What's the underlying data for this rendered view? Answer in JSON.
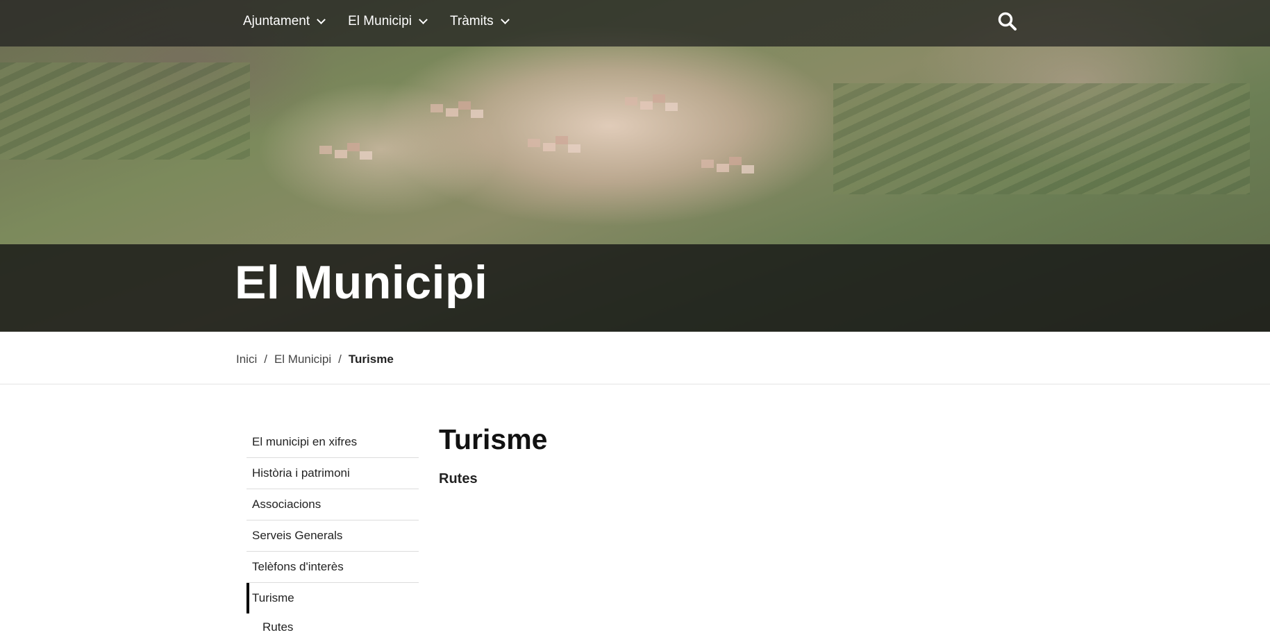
{
  "header": {
    "nav": [
      {
        "label": "Ajuntament"
      },
      {
        "label": "El Municipi"
      },
      {
        "label": "Tràmits"
      }
    ],
    "search_icon": "search-icon"
  },
  "hero": {
    "title": "El Municipi"
  },
  "breadcrumb": {
    "items": [
      "Inici",
      "El Municipi",
      "Turisme"
    ],
    "separator": "/"
  },
  "sidebar": {
    "items": [
      {
        "label": "El municipi en xifres"
      },
      {
        "label": "Història i patrimoni"
      },
      {
        "label": "Associacions"
      },
      {
        "label": "Serveis Generals"
      },
      {
        "label": "Telèfons d'interès"
      },
      {
        "label": "Turisme",
        "active": true
      }
    ],
    "subitems": [
      {
        "label": "Rutes"
      }
    ]
  },
  "main": {
    "title": "Turisme",
    "subtitle": "Rutes"
  },
  "colors": {
    "topbar": "#1e1e1e",
    "active_marker": "#000000",
    "text": "#222222"
  }
}
